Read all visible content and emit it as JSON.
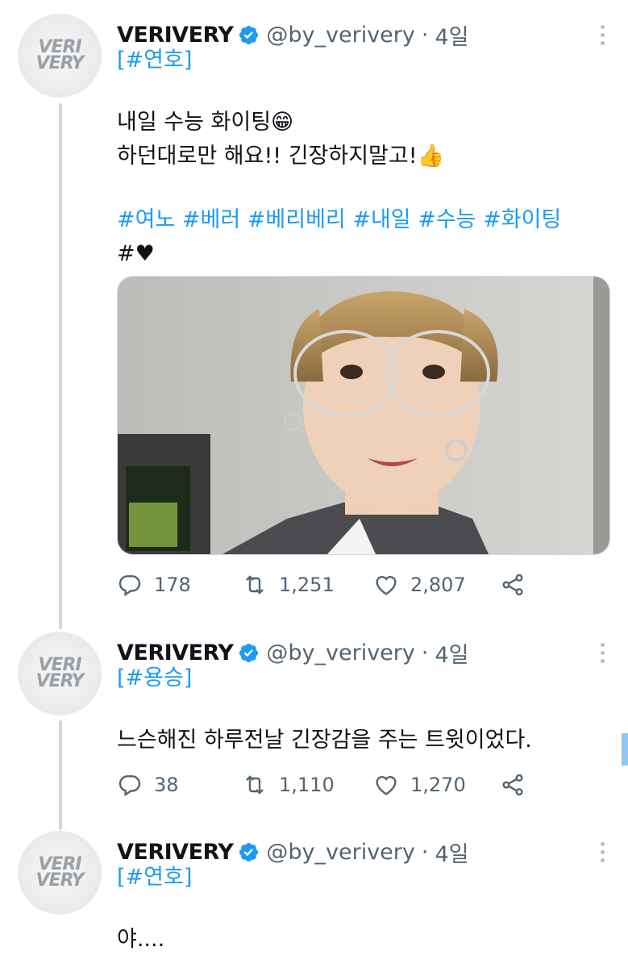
{
  "tweets": [
    {
      "avatar_text_1": "VERI",
      "avatar_text_2": "VERY",
      "name": "VERIVERY",
      "handle": "@by_verivery",
      "dot": "·",
      "time": "4일",
      "tag": "[#연호]",
      "lines": [
        "내일 수능 화이팅😁",
        "하던대로만 해요!! 긴장하지말고!👍"
      ],
      "hashtags": "#여노 #베러 #베리베리 #내일 #수능 #화이팅",
      "heart_tag": "#♥",
      "replies": "178",
      "retweets": "1,251",
      "likes": "2,807"
    },
    {
      "avatar_text_1": "VERI",
      "avatar_text_2": "VERY",
      "name": "VERIVERY",
      "handle": "@by_verivery",
      "dot": "·",
      "time": "4일",
      "tag": "[#용승]",
      "lines": [
        "느슨해진 하루전날 긴장감을 주는 트윗이었다."
      ],
      "replies": "38",
      "retweets": "1,110",
      "likes": "1,270"
    },
    {
      "avatar_text_1": "VERI",
      "avatar_text_2": "VERY",
      "name": "VERIVERY",
      "handle": "@by_verivery",
      "dot": "·",
      "time": "4일",
      "tag": "[#연호]",
      "lines": [
        "야...."
      ]
    }
  ],
  "icons": {
    "reply": "reply-icon",
    "retweet": "retweet-icon",
    "like": "heart-icon",
    "share": "share-icon",
    "verified": "verified-badge-icon",
    "more": "more-icon"
  },
  "colors": {
    "link": "#1d9bf0",
    "secondary": "#536471",
    "verified": "#1d9bf0"
  }
}
